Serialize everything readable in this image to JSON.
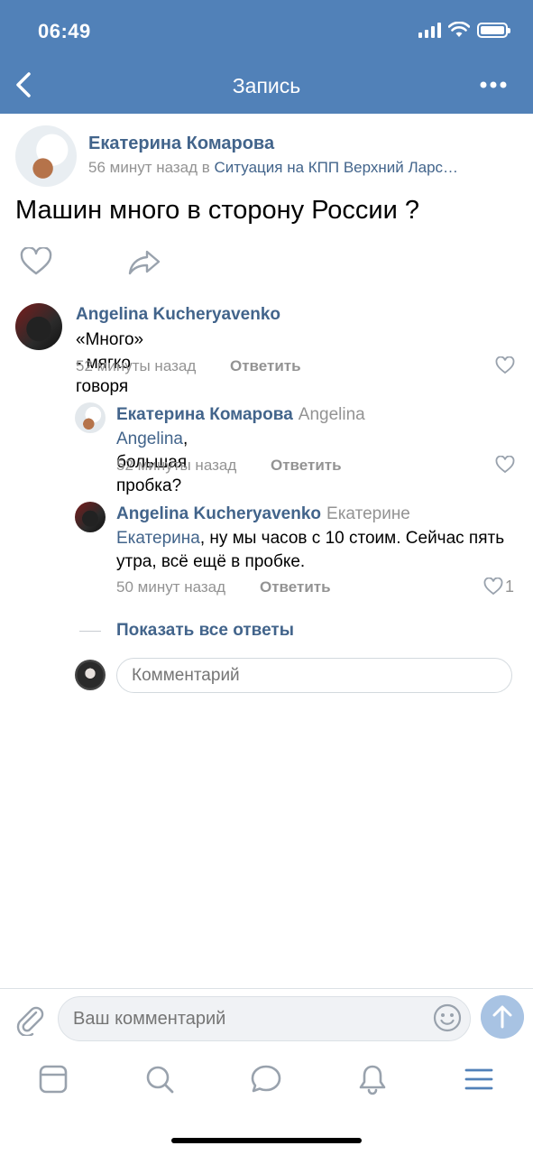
{
  "status_bar": {
    "time": "06:49"
  },
  "nav": {
    "title": "Запись"
  },
  "post": {
    "author": "Екатерина Комарова",
    "time": "56 минут назад в",
    "group": "Ситуация на КПП Верхний Ларс…",
    "text": "Машин много в сторону России ?"
  },
  "comments": [
    {
      "author": "Angelina Kucheryavenko",
      "text": "«Много» - мягко говоря",
      "time": "52 минуты назад",
      "reply_label": "Ответить"
    },
    {
      "author": "Екатерина Комарова",
      "reply_to": "Angelina",
      "mention": "Angelina",
      "text": ", большая пробка?",
      "time": "52 минуты назад",
      "reply_label": "Ответить"
    },
    {
      "author": "Angelina Kucheryavenko",
      "reply_to": "Екатерине",
      "mention": "Екатерина",
      "text": ", ну мы часов с 10 стоим. Сейчас пять утра, всё ещё в пробке.",
      "time": "50 минут назад",
      "reply_label": "Ответить",
      "likes": "1"
    }
  ],
  "show_all_label": "Показать все ответы",
  "inline_comment": {
    "placeholder": "Комментарий"
  },
  "composer": {
    "placeholder": "Ваш комментарий"
  },
  "colors": {
    "header": "#5181b8",
    "link": "#42648b",
    "secondary": "#939393",
    "accent": "#5181b8"
  },
  "icons": [
    "back-icon",
    "more-icon",
    "heart-icon",
    "share-icon",
    "attach-icon",
    "emoji-icon",
    "send-icon",
    "news-icon",
    "search-icon",
    "messages-icon",
    "notifications-icon",
    "menu-icon"
  ]
}
